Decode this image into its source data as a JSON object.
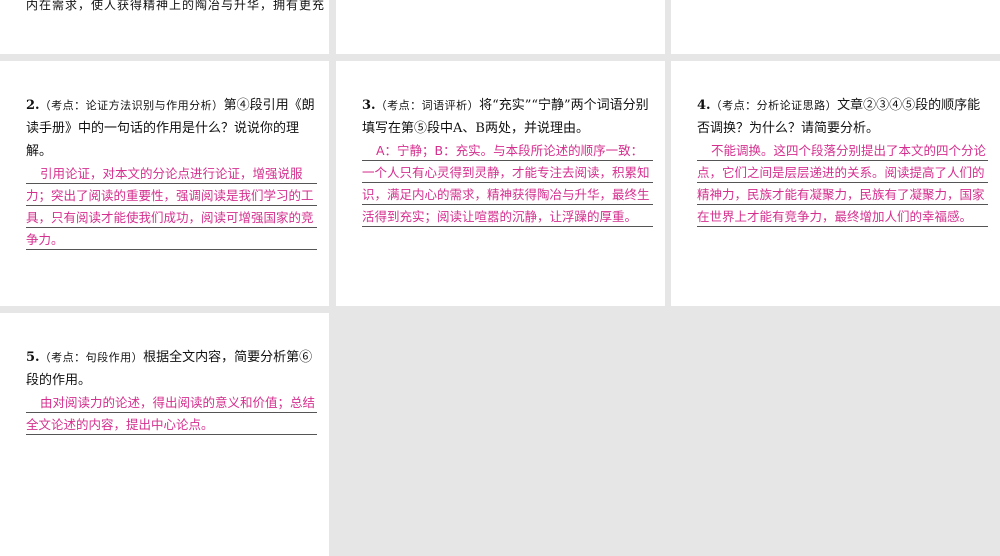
{
  "top_snippet": "内在需求，使人获得精神上的陶冶与升华，拥有更充",
  "questions": {
    "q2": {
      "number": "2.",
      "tag": "（考点：论证方法识别与作用分析）",
      "prompt": "第④段引用《朗读手册》中的一句话的作用是什么？说说你的理解。",
      "answer": "引用论证，对本文的分论点进行论证，增强说服力；突出了阅读的重要性，强调阅读是我们学习的工具，只有阅读才能使我们成功，阅读可增强国家的竞争力。"
    },
    "q3": {
      "number": "3.",
      "tag": "（考点：词语评析）",
      "prompt": "将“充实”“宁静”两个词语分别填写在第⑤段中A、B两处，并说理由。",
      "answer": "A：宁静；B：充实。与本段所论述的顺序一致：一个人只有心灵得到灵静，才能专注去阅读，积累知识，满足内心的需求，精神获得陶冶与升华，最终生活得到充实；阅读让喧嚣的沉静，让浮躁的厚重。"
    },
    "q4": {
      "number": "4.",
      "tag": "（考点：分析论证思路）",
      "prompt": "文章②③④⑤段的顺序能否调换？为什么？请简要分析。",
      "answer": "不能调换。这四个段落分别提出了本文的四个分论点，它们之间是层层递进的关系。阅读提高了人们的精神力，民族才能有凝聚力，民族有了凝聚力，国家在世界上才能有竞争力，最终增加人们的幸福感。"
    },
    "q5": {
      "number": "5.",
      "tag": "（考点：句段作用）",
      "prompt": "根据全文内容，简要分析第⑥段的作用。",
      "answer": "由对阅读力的论述，得出阅读的意义和价值；总结全文论述的内容，提出中心论点。"
    }
  },
  "colors": {
    "background": "#e6e6e6",
    "tile": "#ffffff",
    "answer": "#d42f8e",
    "text": "#111111"
  }
}
